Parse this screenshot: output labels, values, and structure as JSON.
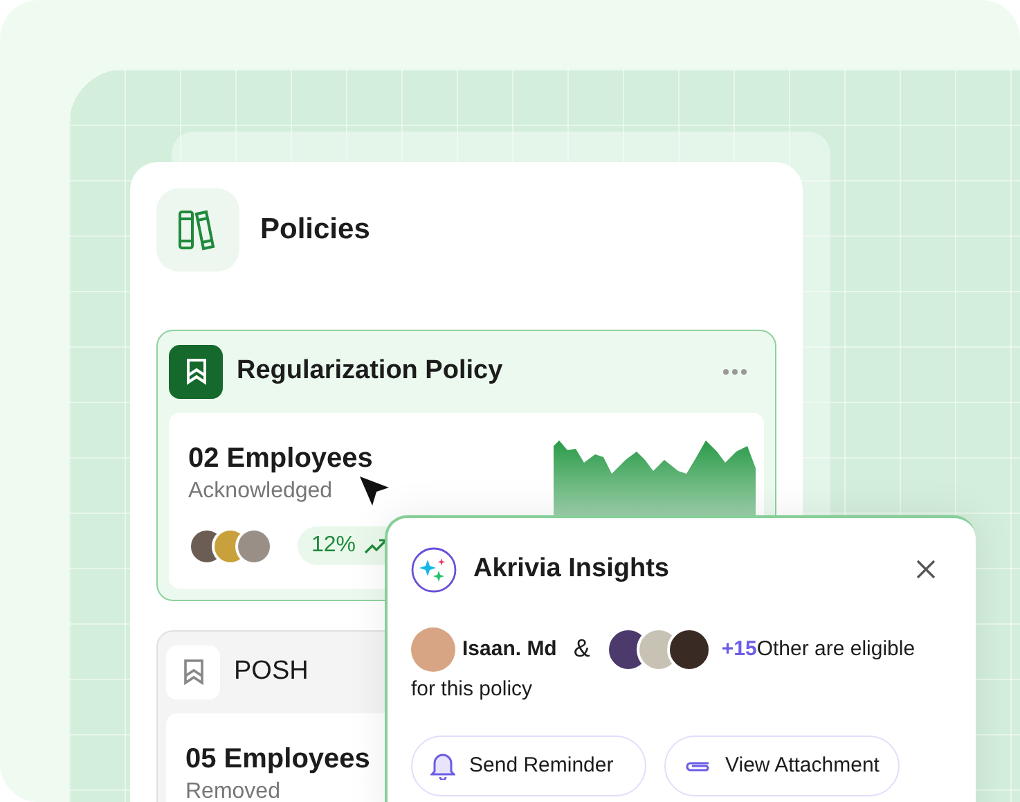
{
  "title": "Policies",
  "policies": [
    {
      "name": "Regularization Policy",
      "selected": true,
      "count": "02 Employees",
      "status": "Acknowledged",
      "change": "12%"
    },
    {
      "name": "POSH",
      "selected": false,
      "count": "05 Employees",
      "status": "Removed"
    }
  ],
  "insights": {
    "title": "Akrivia Insights",
    "person": "Isaan. Md",
    "conjunction": "&",
    "extra": "+15",
    "message": "Other are eligible",
    "message_continued": "for this policy",
    "buttons": [
      {
        "kind": "bell",
        "label": "Send Reminder"
      },
      {
        "kind": "clip",
        "label": "View Attachment"
      }
    ]
  }
}
